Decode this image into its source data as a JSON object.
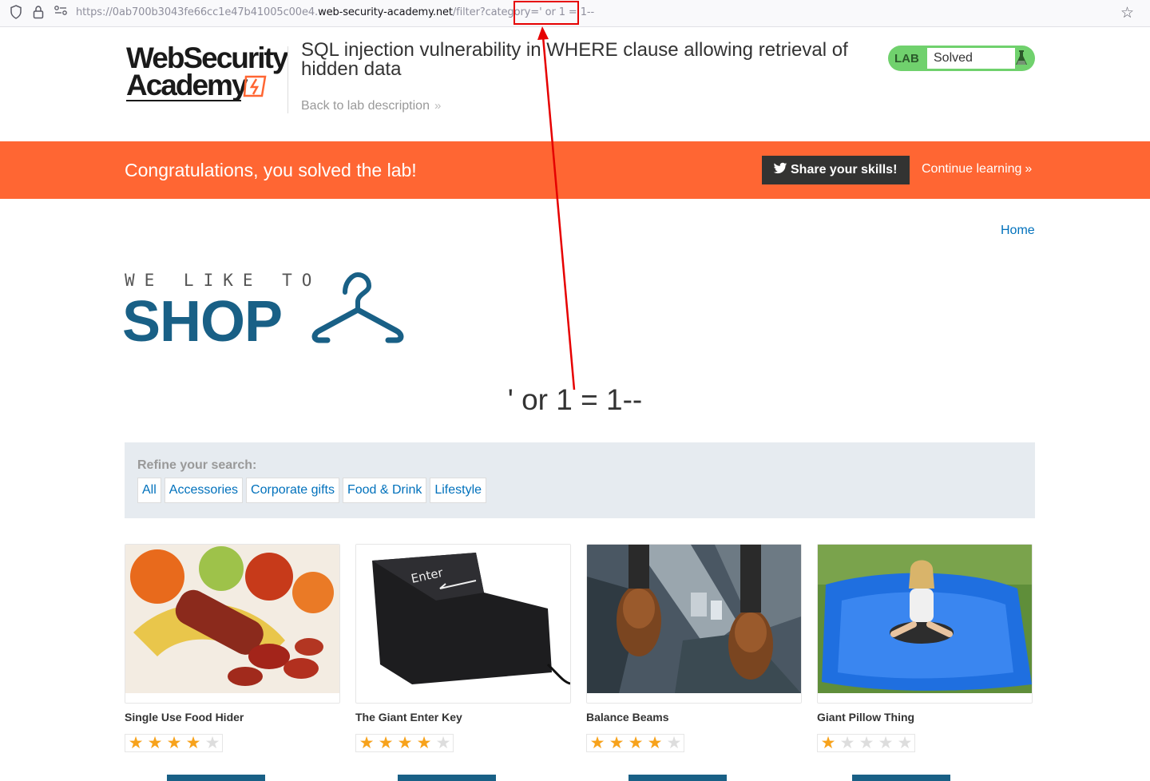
{
  "browser": {
    "url_prefix": "https://0ab700b3043fe66cc1e47b41005c00e4.",
    "url_host": "web-security-academy.net",
    "url_path": "/filter?category=",
    "url_query": "' or 1 = 1--"
  },
  "header": {
    "logo_line1": "WebSecurity",
    "logo_line2": "Academy",
    "lab_title": "SQL injection vulnerability in WHERE clause allowing retrieval of hidden data",
    "back_link": "Back to lab description",
    "lab_badge": "LAB",
    "lab_state": "Solved"
  },
  "banner": {
    "message": "Congratulations, you solved the lab!",
    "share_label": "Share your skills!",
    "continue_label": "Continue learning"
  },
  "nav": {
    "home": "Home"
  },
  "shop_logo": {
    "tagline": "WE LIKE TO",
    "word": "SHOP"
  },
  "search_heading": "' or 1 = 1--",
  "refine": {
    "label": "Refine your search:",
    "categories": [
      "All",
      "Accessories",
      "Corporate gifts",
      "Food & Drink",
      "Lifestyle"
    ]
  },
  "products": [
    {
      "name": "Single Use Food Hider",
      "rating": 4
    },
    {
      "name": "The Giant Enter Key",
      "rating": 4
    },
    {
      "name": "Balance Beams",
      "rating": 4
    },
    {
      "name": "Giant Pillow Thing",
      "rating": 1
    }
  ],
  "colors": {
    "accent": "#ff6633",
    "link": "#0071bc",
    "shop_blue": "#196086",
    "solved_green": "#70d16d",
    "annotation_red": "#e60000"
  }
}
